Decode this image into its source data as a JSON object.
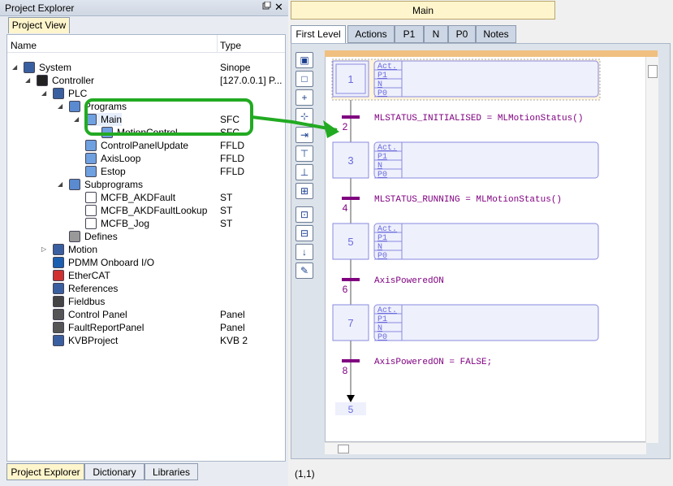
{
  "explorer": {
    "title": "Project Explorer",
    "pin_icon": "pin-icon",
    "close_label": "✕",
    "view_tab": "Project View",
    "col_name": "Name",
    "col_type": "Type",
    "items": [
      {
        "label": "System",
        "type": "Sinope",
        "icon": "system-icon"
      },
      {
        "label": "Controller",
        "type": "[127.0.0.1] P...",
        "icon": "controller-icon"
      },
      {
        "label": "PLC",
        "type": "",
        "icon": "plc-icon"
      },
      {
        "label": "Programs",
        "type": "",
        "icon": "programs-icon"
      },
      {
        "label": "Main",
        "type": "SFC",
        "icon": "sfc-icon"
      },
      {
        "label": "MotionControl",
        "type": "SFC",
        "icon": "sfc-icon"
      },
      {
        "label": "ControlPanelUpdate",
        "type": "FFLD",
        "icon": "ffld-icon"
      },
      {
        "label": "AxisLoop",
        "type": "FFLD",
        "icon": "ffld-icon"
      },
      {
        "label": "Estop",
        "type": "FFLD",
        "icon": "ffld-icon"
      },
      {
        "label": "Subprograms",
        "type": "",
        "icon": "subprograms-icon"
      },
      {
        "label": "MCFB_AKDFault",
        "type": "ST",
        "icon": "st-icon"
      },
      {
        "label": "MCFB_AKDFaultLookup",
        "type": "ST",
        "icon": "st-icon"
      },
      {
        "label": "MCFB_Jog",
        "type": "ST",
        "icon": "st-icon"
      },
      {
        "label": "Defines",
        "type": "",
        "icon": "defines-icon"
      },
      {
        "label": "Motion",
        "type": "",
        "icon": "motion-icon"
      },
      {
        "label": "PDMM Onboard I/O",
        "type": "",
        "icon": "io-icon"
      },
      {
        "label": "EtherCAT",
        "type": "",
        "icon": "ethercat-icon"
      },
      {
        "label": "References",
        "type": "",
        "icon": "references-icon"
      },
      {
        "label": "Fieldbus",
        "type": "",
        "icon": "fieldbus-icon"
      },
      {
        "label": "Control Panel",
        "type": "Panel",
        "icon": "panel-icon"
      },
      {
        "label": "FaultReportPanel",
        "type": "Panel",
        "icon": "panel-icon"
      },
      {
        "label": "KVBProject",
        "type": "KVB 2",
        "icon": "kvb-icon"
      }
    ],
    "bottom_tabs": [
      "Project Explorer",
      "Dictionary",
      "Libraries"
    ]
  },
  "editor": {
    "doc_tab": "Main",
    "tabs": [
      "First Level",
      "Actions",
      "P1",
      "N",
      "P0",
      "Notes"
    ],
    "coords": "(1,1)",
    "action_labels": [
      "Act.",
      "P1",
      "N",
      "P0"
    ],
    "steps": [
      "1",
      "3",
      "5",
      "7"
    ],
    "transitions": [
      {
        "num": "2",
        "cond": "MLSTATUS_INITIALISED = MLMotionStatus()"
      },
      {
        "num": "4",
        "cond": "MLSTATUS_RUNNING = MLMotionStatus()"
      },
      {
        "num": "6",
        "cond": "AxisPoweredON"
      },
      {
        "num": "8",
        "cond": "AxisPoweredON = FALSE;"
      }
    ],
    "jump_target": "5"
  },
  "colors": {
    "accent_tab": "#fff5cc",
    "transition": "#800080",
    "step_text": "#6a6adc",
    "arrow": "#22aa22"
  }
}
